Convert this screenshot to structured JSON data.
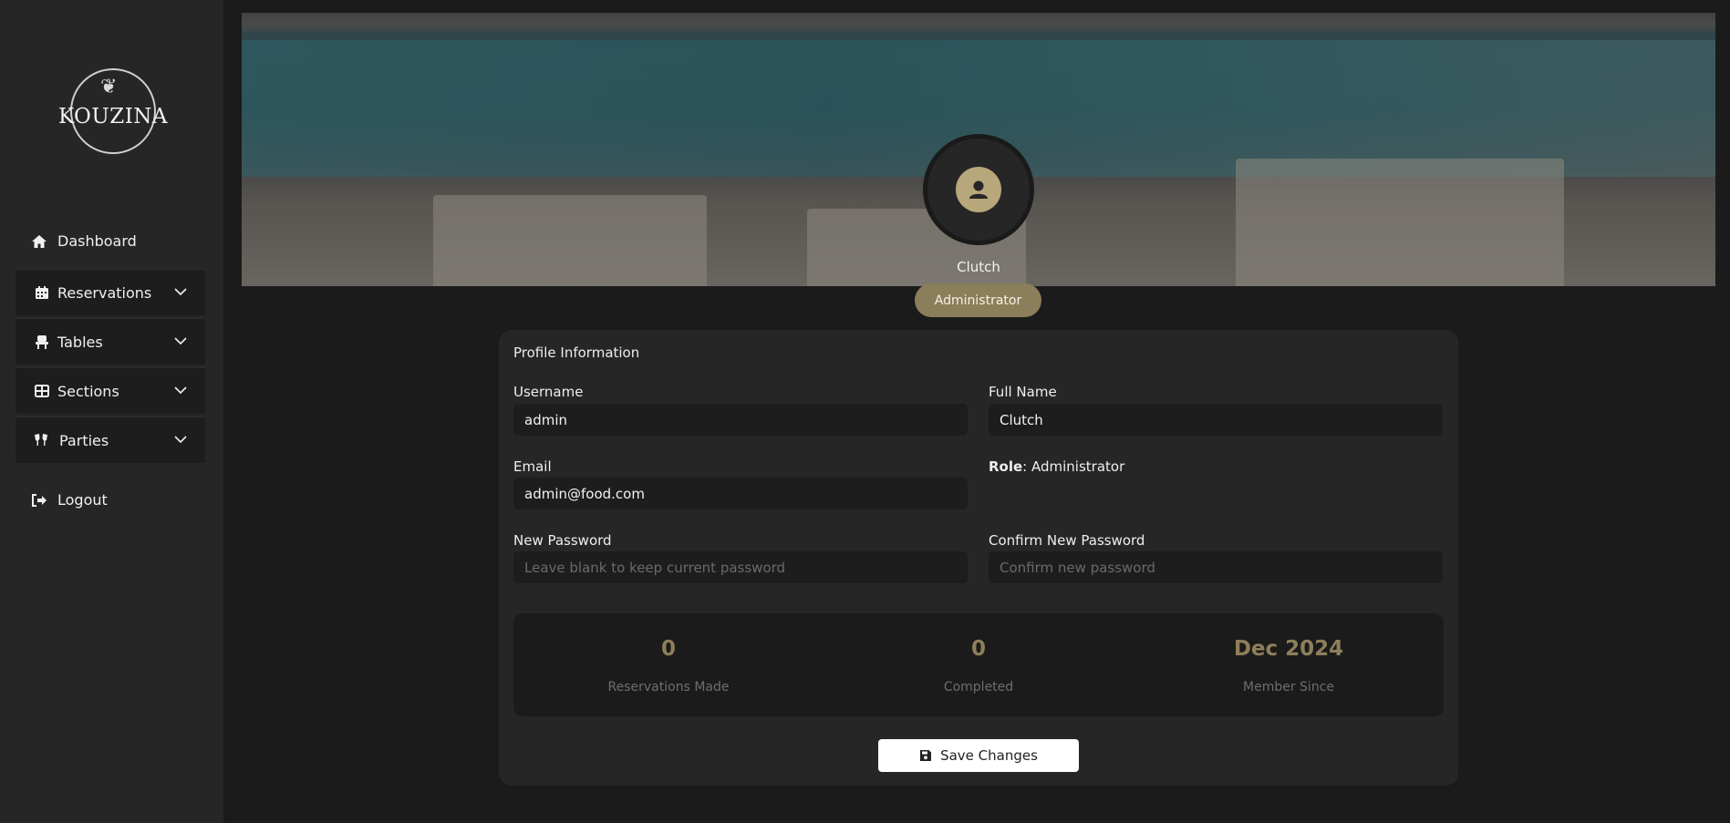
{
  "brand": {
    "name": "KOUZINA"
  },
  "sidebar": {
    "items": [
      {
        "label": "Dashboard",
        "icon": "home-icon"
      },
      {
        "label": "Reservations",
        "icon": "calendar-icon"
      },
      {
        "label": "Tables",
        "icon": "chair-icon"
      },
      {
        "label": "Sections",
        "icon": "grid-icon"
      },
      {
        "label": "Parties",
        "icon": "glasses-icon"
      },
      {
        "label": "Logout",
        "icon": "logout-icon"
      }
    ]
  },
  "hero": {
    "name": "Clutch",
    "role": "Administrator"
  },
  "profile": {
    "title": "Profile Information",
    "username_label": "Username",
    "username": "admin",
    "fullname_label": "Full Name",
    "fullname": "Clutch",
    "email_label": "Email",
    "email": "admin@food.com",
    "role_label": "Role",
    "role_value": ": Administrator",
    "new_password_label": "New Password",
    "new_password_placeholder": "Leave blank to keep current password",
    "confirm_password_label": "Confirm New Password",
    "confirm_password_placeholder": "Confirm new password"
  },
  "stats": [
    {
      "value": "0",
      "label": "Reservations Made"
    },
    {
      "value": "0",
      "label": "Completed"
    },
    {
      "value": "Dec 2024",
      "label": "Member Since"
    }
  ],
  "actions": {
    "save_label": "Save Changes"
  },
  "colors": {
    "accent": "#8b7e5a",
    "sidebar": "#262626",
    "background": "#1b1b1b",
    "card": "#262626"
  }
}
